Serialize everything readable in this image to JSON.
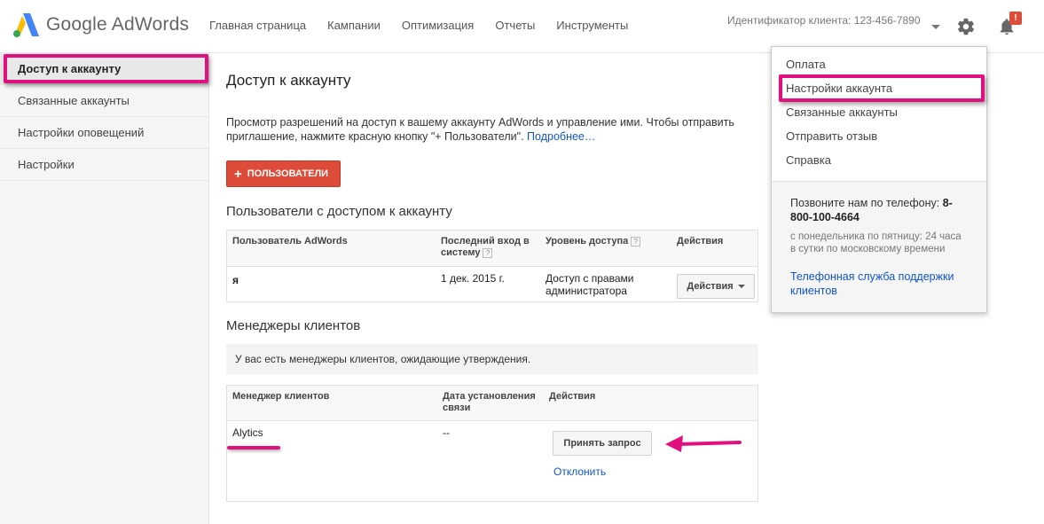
{
  "app": {
    "logo_text": "Google AdWords"
  },
  "nav": [
    "Главная страница",
    "Кампании",
    "Оптимизация",
    "Отчеты",
    "Инструменты"
  ],
  "header": {
    "client_id": "Идентификатор клиента: 123-456-7890",
    "notification_badge": "!"
  },
  "sidebar": {
    "items": [
      {
        "label": "Доступ к аккаунту"
      },
      {
        "label": "Связанные аккаунты"
      },
      {
        "label": "Настройки оповещений"
      },
      {
        "label": "Настройки"
      }
    ]
  },
  "main": {
    "title": "Доступ к аккаунту",
    "intro_text": "Просмотр разрешений на доступ к вашему аккаунту AdWords и управление ими. Чтобы отправить приглашение, нажмите красную кнопку \"+ Пользователи\".",
    "intro_link": "Подробнее…",
    "add_button_plus": "+",
    "add_button": "ПОЛЬЗОВАТЕЛИ",
    "users_section": {
      "title": "Пользователи с доступом к аккаунту",
      "columns": [
        "Пользователь AdWords",
        "Последний вход в систему",
        "Уровень доступа",
        "Действия"
      ],
      "rows": [
        {
          "user": "я",
          "last_login": "1 дек. 2015 г.",
          "access": "Доступ с правами администратора",
          "action_button": "Действия"
        }
      ]
    },
    "managers_section": {
      "title": "Менеджеры клиентов",
      "notice": "У вас есть менеджеры клиентов, ожидающие утверждения.",
      "columns": [
        "Менеджер клиентов",
        "Дата установления связи",
        "Действия"
      ],
      "rows": [
        {
          "manager": "Alytics",
          "date": "--",
          "accept_button": "Принять запрос",
          "decline_link": "Отклонить"
        }
      ]
    }
  },
  "dropdown": {
    "items": [
      "Оплата",
      "Настройки аккаунта",
      "Связанные аккаунты",
      "Отправить отзыв",
      "Справка"
    ],
    "phone_label": "Позвоните нам по телефону:",
    "phone_number": "8-800-100-4664",
    "hours": "с понедельника по пятницу: 24 часа в сутки по московскому времени",
    "support_link": "Телефонная служба поддержки клиентов"
  },
  "colors": {
    "accent_red": "#dd4b39",
    "highlight_magenta": "#e0117f",
    "link_blue": "#1155cc"
  }
}
